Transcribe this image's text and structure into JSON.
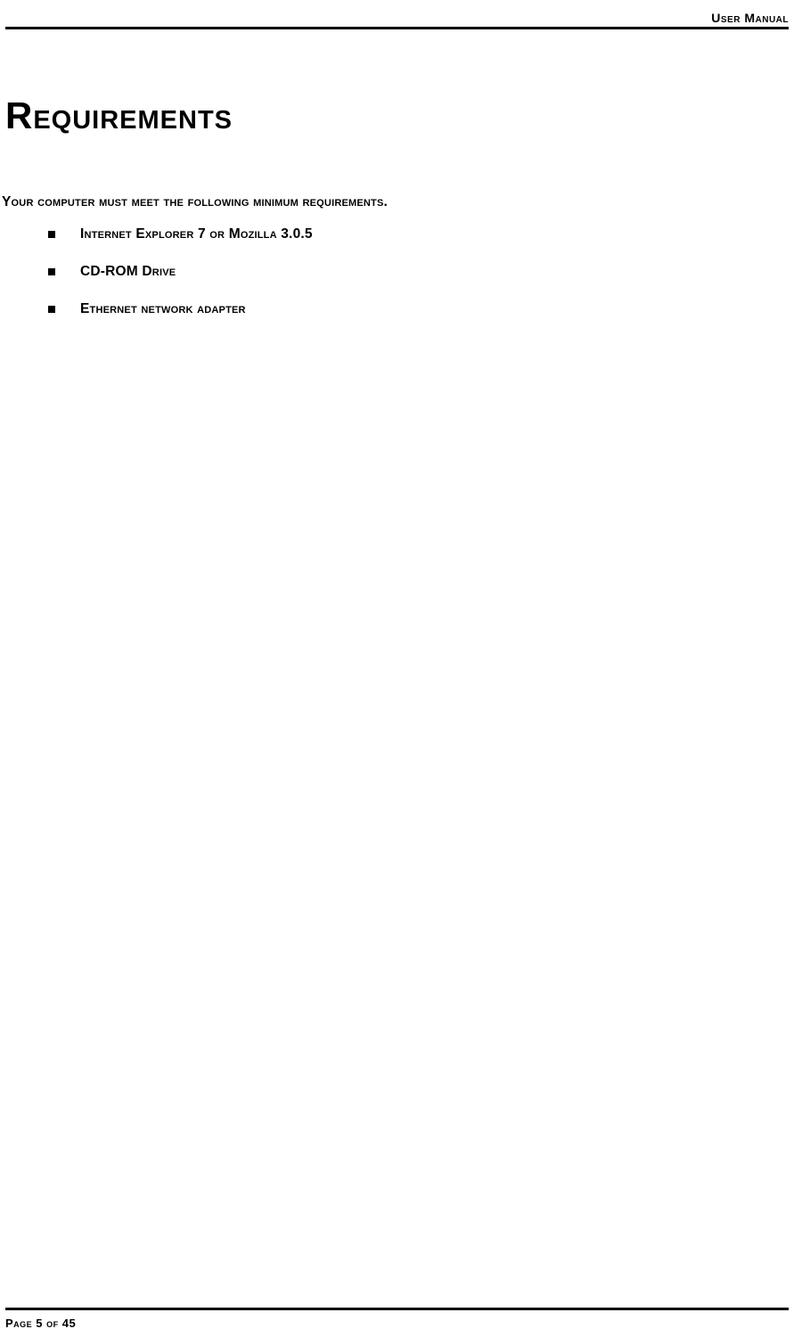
{
  "header": {
    "label": "User Manual"
  },
  "title": "Requirements",
  "intro": "Your computer must meet the following minimum requirements.",
  "bullets": [
    "Internet Explorer 7 or Mozilla 3.0.5",
    "CD-ROM Drive",
    "Ethernet network adapter"
  ],
  "footer": {
    "label": "Page 5 of 45"
  }
}
